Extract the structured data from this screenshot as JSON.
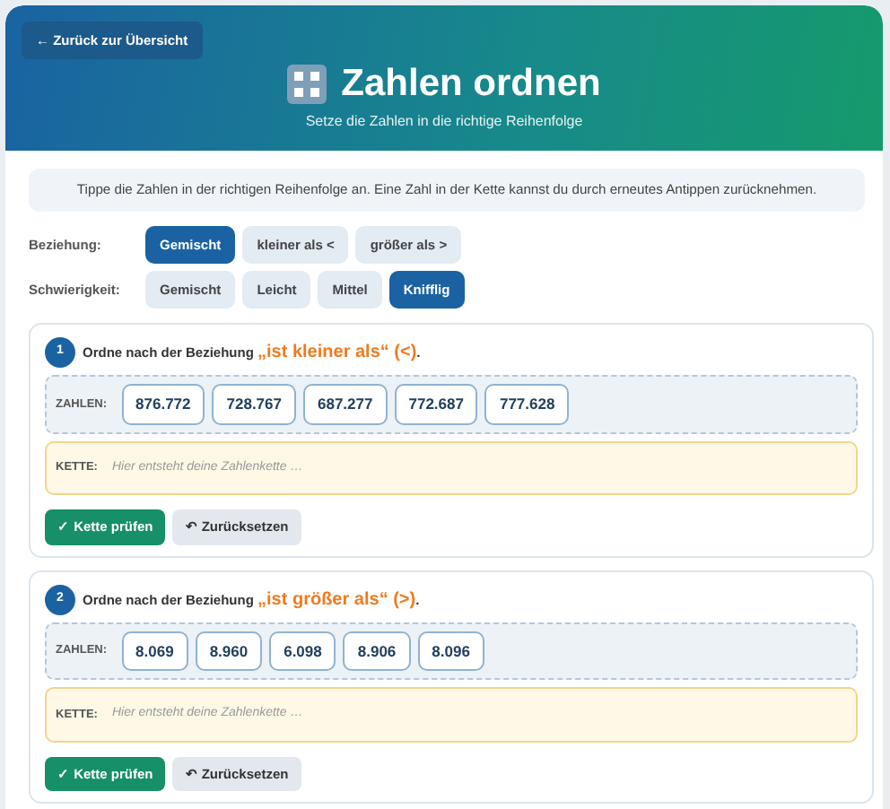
{
  "header": {
    "back_button": "← Zurück zur Übersicht",
    "title": "Zahlen ordnen",
    "subtitle": "Setze die Zahlen in die richtige Reihenfolge"
  },
  "hint": "Tippe die Zahlen in der richtigen Reihenfolge an. Eine Zahl in der Kette kannst du durch erneutes Antippen zurücknehmen.",
  "filters": [
    {
      "label": "Beziehung:",
      "options": [
        {
          "label": "Gemischt",
          "selected": true
        },
        {
          "label": "kleiner als <",
          "selected": false
        },
        {
          "label": "größer als >",
          "selected": false
        }
      ]
    },
    {
      "label": "Schwierigkeit:",
      "options": [
        {
          "label": "Gemischt",
          "selected": false
        },
        {
          "label": "Leicht",
          "selected": false
        },
        {
          "label": "Mittel",
          "selected": false
        },
        {
          "label": "Knifflig",
          "selected": true
        }
      ]
    }
  ],
  "tasks": [
    {
      "number": "1",
      "prompt": "Ordne nach der Beziehung",
      "relation": "„ist kleiner als“ (<)",
      "end": ".",
      "numbers_label": "ZAHLEN:",
      "numbers": [
        "876.772",
        "728.767",
        "687.277",
        "772.687",
        "777.628"
      ],
      "chain_label": "KETTE:",
      "chain_placeholder": "Hier entsteht deine Zahlenkette …",
      "check_button": "✓ Kette prüfen",
      "reset_button": "↶ Zurücksetzen"
    },
    {
      "number": "2",
      "prompt": "Ordne nach der Beziehung",
      "relation": "„ist größer als“ (>)",
      "end": ".",
      "numbers_label": "ZAHLEN:",
      "numbers": [
        "8.069",
        "8.960",
        "6.098",
        "8.906",
        "8.096"
      ],
      "chain_label": "KETTE:",
      "chain_placeholder": "Hier entsteht deine Zahlenkette …",
      "check_button": "✓ Kette prüfen",
      "reset_button": "↶ Zurücksetzen"
    }
  ]
}
